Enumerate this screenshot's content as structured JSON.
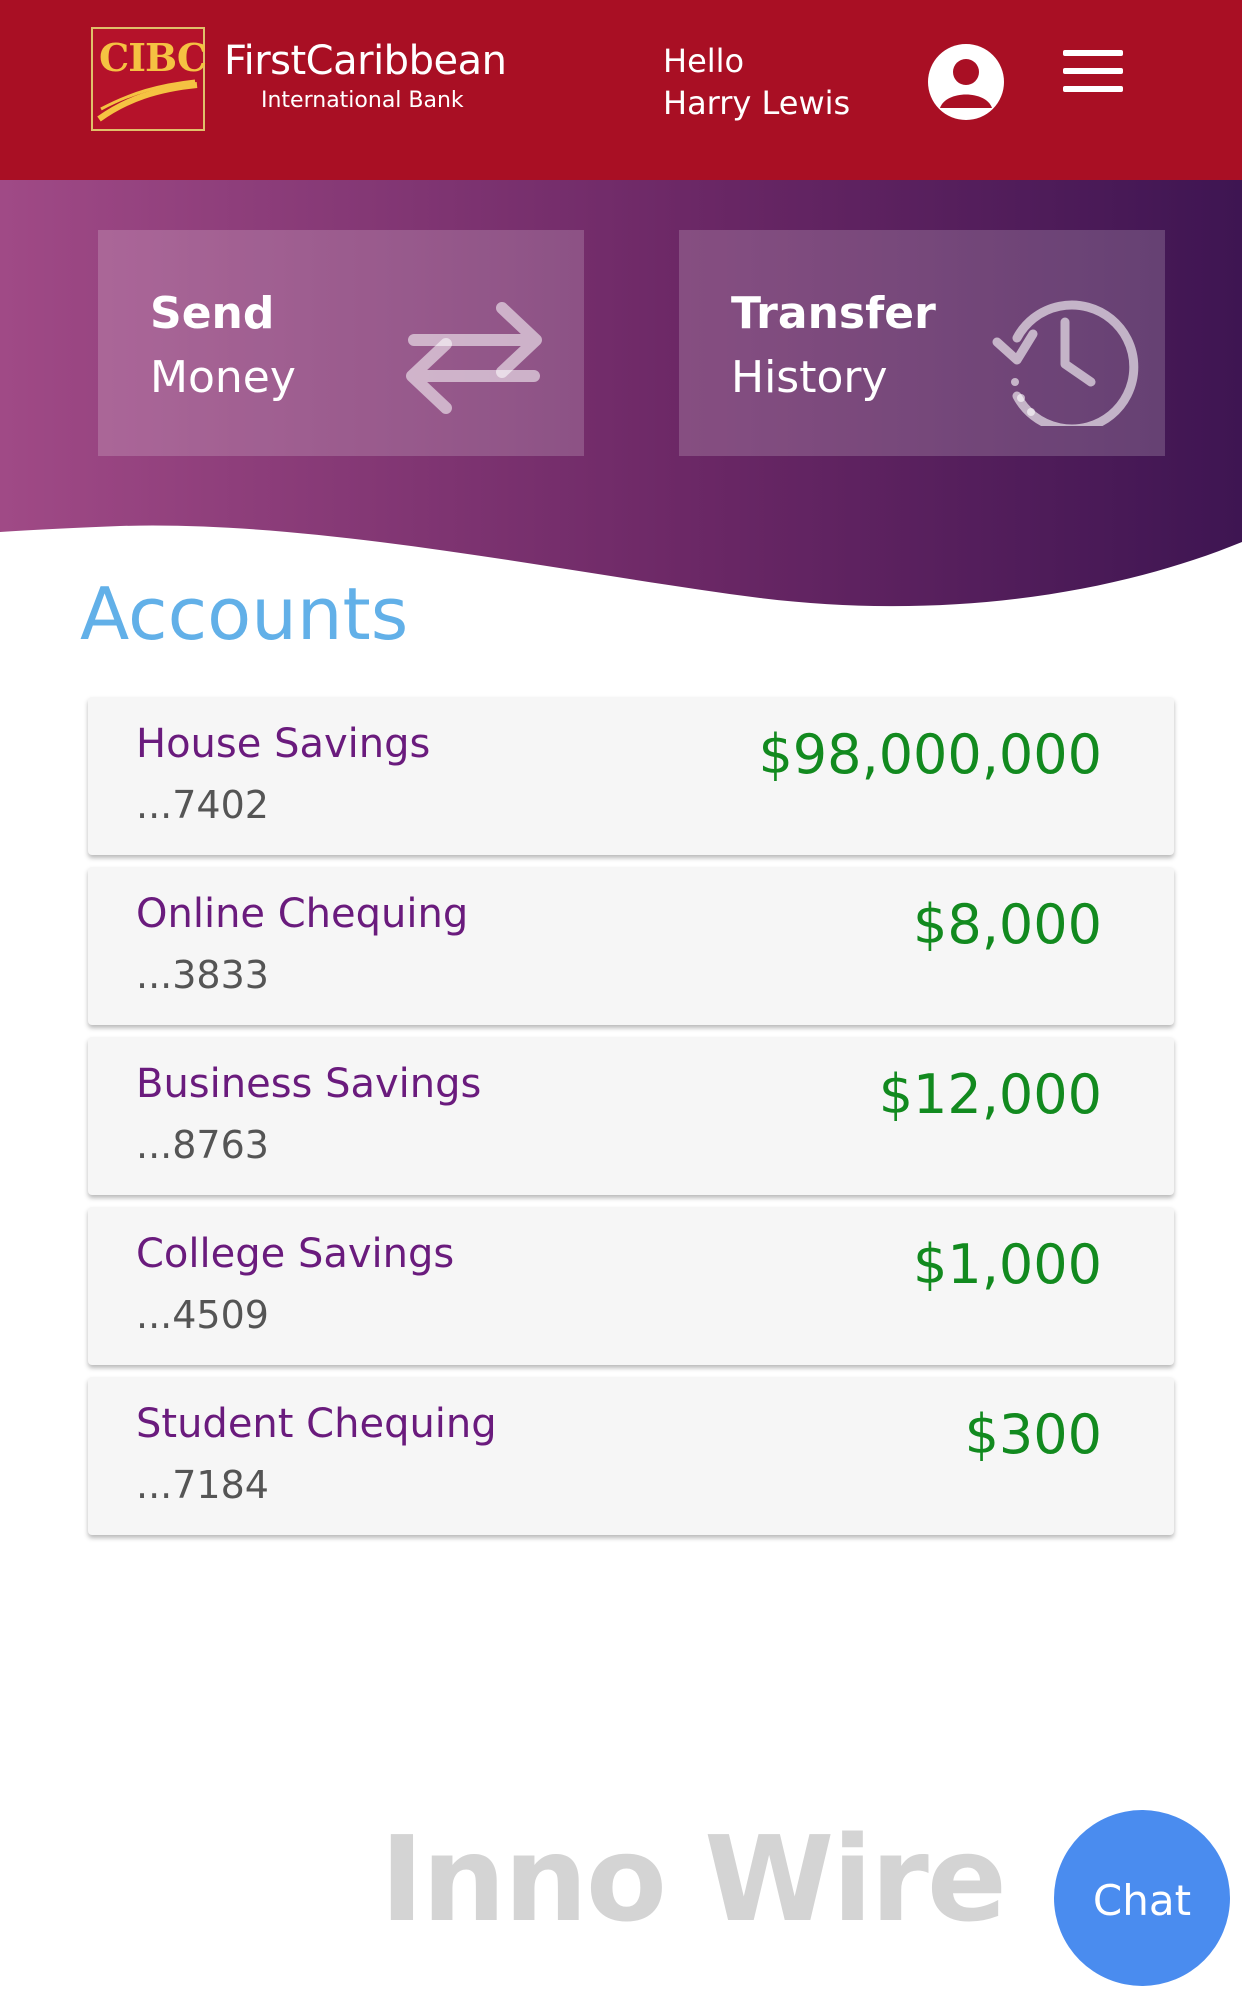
{
  "header": {
    "logo_mark": "CIBC",
    "brand_name": "FirstCaribbean",
    "brand_subtitle": "International Bank",
    "greeting_line1": "Hello",
    "greeting_line2": "Harry Lewis",
    "profile_icon": "account-circle-icon",
    "menu_icon": "hamburger-menu-icon",
    "background_color": "#a90f24"
  },
  "quick_actions": [
    {
      "line1": "Send",
      "line2": "Money",
      "icon": "swap-arrows-icon"
    },
    {
      "line1": "Transfer",
      "line2": "History",
      "icon": "history-clock-icon"
    }
  ],
  "accounts": {
    "title": "Accounts",
    "items": [
      {
        "name": "House Savings",
        "number": "...7402",
        "balance": "$98,000,000"
      },
      {
        "name": "Online Chequing",
        "number": "...3833",
        "balance": "$8,000"
      },
      {
        "name": "Business Savings",
        "number": "...8763",
        "balance": "$12,000"
      },
      {
        "name": "College Savings",
        "number": "...4509",
        "balance": "$1,000"
      },
      {
        "name": "Student Chequing",
        "number": "...7184",
        "balance": "$300"
      }
    ]
  },
  "footer": {
    "brand_text": "Inno Wire",
    "chat_label": "Chat"
  },
  "colors": {
    "header_red": "#a90f24",
    "hero_start": "#a04a86",
    "hero_end": "#3e1552",
    "accounts_title": "#62b0e8",
    "account_name": "#6a1b7d",
    "balance_green": "#128a1f",
    "chat_blue": "#4a8cef"
  }
}
